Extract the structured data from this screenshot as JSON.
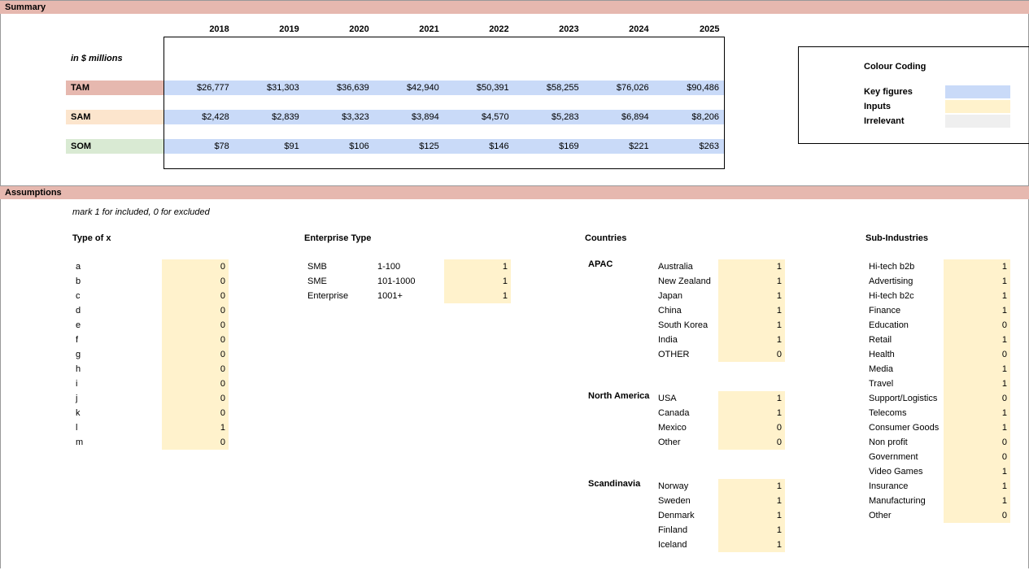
{
  "sections": {
    "summary": "Summary",
    "assumptions": "Assumptions"
  },
  "summary": {
    "units_label": "in $ millions",
    "years": [
      "2018",
      "2019",
      "2020",
      "2021",
      "2022",
      "2023",
      "2024",
      "2025"
    ],
    "rows": {
      "tam": {
        "label": "TAM",
        "values": [
          "$26,777",
          "$31,303",
          "$36,639",
          "$42,940",
          "$50,391",
          "$58,255",
          "$76,026",
          "$90,486"
        ]
      },
      "sam": {
        "label": "SAM",
        "values": [
          "$2,428",
          "$2,839",
          "$3,323",
          "$3,894",
          "$4,570",
          "$5,283",
          "$6,894",
          "$8,206"
        ]
      },
      "som": {
        "label": "SOM",
        "values": [
          "$78",
          "$91",
          "$106",
          "$125",
          "$146",
          "$169",
          "$221",
          "$263"
        ]
      }
    }
  },
  "legend": {
    "title": "Colour Coding",
    "key_figures": "Key figures",
    "inputs": "Inputs",
    "irrelevant": "Irrelevant"
  },
  "assumptions": {
    "note": "mark 1 for included, 0 for excluded",
    "type_x": {
      "heading": "Type of x",
      "items": [
        {
          "name": "a",
          "val": "0"
        },
        {
          "name": "b",
          "val": "0"
        },
        {
          "name": "c",
          "val": "0"
        },
        {
          "name": "d",
          "val": "0"
        },
        {
          "name": "e",
          "val": "0"
        },
        {
          "name": "f",
          "val": "0"
        },
        {
          "name": "g",
          "val": "0"
        },
        {
          "name": "h",
          "val": "0"
        },
        {
          "name": "i",
          "val": "0"
        },
        {
          "name": "j",
          "val": "0"
        },
        {
          "name": "k",
          "val": "0"
        },
        {
          "name": "l",
          "val": "1"
        },
        {
          "name": "m",
          "val": "0"
        }
      ]
    },
    "enterprise": {
      "heading": "Enterprise Type",
      "items": [
        {
          "name": "SMB",
          "range": "1-100",
          "val": "1"
        },
        {
          "name": "SME",
          "range": "101-1000",
          "val": "1"
        },
        {
          "name": "Enterprise",
          "range": "1001+",
          "val": "1"
        }
      ]
    },
    "countries": {
      "heading": "Countries",
      "regions": [
        {
          "name": "APAC",
          "items": [
            {
              "name": "Australia",
              "val": "1"
            },
            {
              "name": "New Zealand",
              "val": "1"
            },
            {
              "name": "Japan",
              "val": "1"
            },
            {
              "name": "China",
              "val": "1"
            },
            {
              "name": "South Korea",
              "val": "1"
            },
            {
              "name": "India",
              "val": "1"
            },
            {
              "name": "OTHER",
              "val": "0"
            }
          ]
        },
        {
          "name": "North America",
          "items": [
            {
              "name": "USA",
              "val": "1"
            },
            {
              "name": "Canada",
              "val": "1"
            },
            {
              "name": "Mexico",
              "val": "0"
            },
            {
              "name": "Other",
              "val": "0"
            }
          ]
        },
        {
          "name": "Scandinavia",
          "items": [
            {
              "name": "Norway",
              "val": "1"
            },
            {
              "name": "Sweden",
              "val": "1"
            },
            {
              "name": "Denmark",
              "val": "1"
            },
            {
              "name": "Finland",
              "val": "1"
            },
            {
              "name": "Iceland",
              "val": "1"
            }
          ]
        }
      ]
    },
    "sub_industries": {
      "heading": "Sub-Industries",
      "items": [
        {
          "name": "Hi-tech b2b",
          "val": "1"
        },
        {
          "name": "Advertising",
          "val": "1"
        },
        {
          "name": "Hi-tech b2c",
          "val": "1"
        },
        {
          "name": "Finance",
          "val": "1"
        },
        {
          "name": "Education",
          "val": "0"
        },
        {
          "name": "Retail",
          "val": "1"
        },
        {
          "name": "Health",
          "val": "0"
        },
        {
          "name": "Media",
          "val": "1"
        },
        {
          "name": "Travel",
          "val": "1"
        },
        {
          "name": "Support/Logistics",
          "val": "0"
        },
        {
          "name": "Telecoms",
          "val": "1"
        },
        {
          "name": "Consumer Goods",
          "val": "1"
        },
        {
          "name": "Non profit",
          "val": "0"
        },
        {
          "name": "Government",
          "val": "0"
        },
        {
          "name": "Video Games",
          "val": "1"
        },
        {
          "name": "Insurance",
          "val": "1"
        },
        {
          "name": "Manufacturing",
          "val": "1"
        },
        {
          "name": "Other",
          "val": "0"
        }
      ]
    }
  }
}
